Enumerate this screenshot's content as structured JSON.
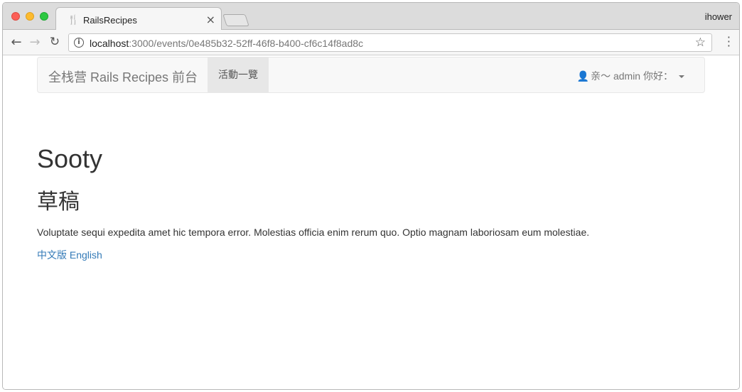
{
  "browser": {
    "tab_title": "RailsRecipes",
    "profile_name": "ihower",
    "url_host": "localhost",
    "url_rest": ":3000/events/0e485b32-52ff-46f8-b400-cf6c14f8ad8c",
    "icons": {
      "tab": "fork-knife-icon",
      "close": "close-icon",
      "back": "arrow-left-icon",
      "forward": "arrow-right-icon",
      "reload": "reload-icon",
      "info": "info-icon",
      "bookmark": "star-icon",
      "menu": "kebab-menu-icon"
    }
  },
  "navbar": {
    "brand": "全栈营 Rails Recipes 前台",
    "active_item": "活動一覽",
    "user_greeting": "亲～ admin 你好："
  },
  "event": {
    "name": "Sooty",
    "status": "草稿",
    "description": "Voluptate sequi expedita amet hic tempora error. Molestias officia enim rerum quo. Optio magnam laboriosam eum molestiae.",
    "lang_zh": "中文版",
    "lang_en": "English"
  },
  "colors": {
    "link": "#337ab7",
    "navbar_bg": "#f8f8f8",
    "active_bg": "#e7e7e7"
  }
}
